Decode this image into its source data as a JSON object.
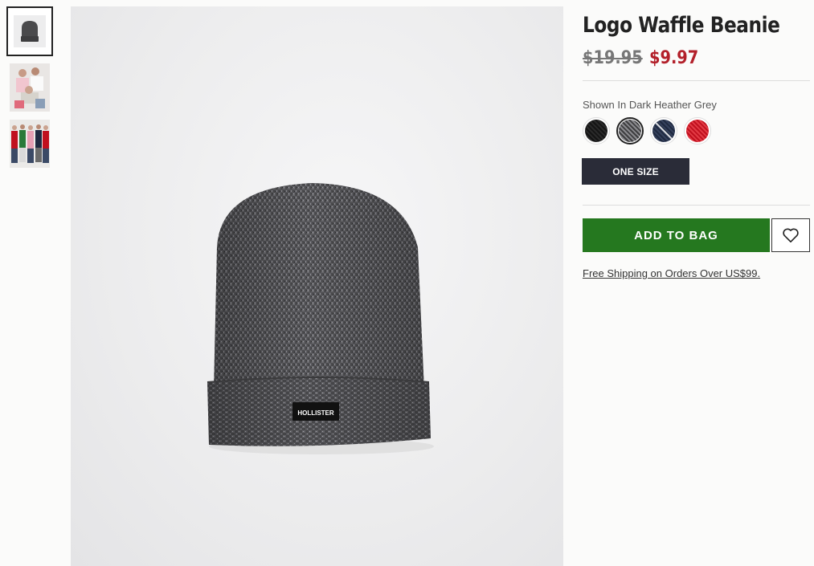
{
  "product": {
    "title": "Logo Waffle Beanie",
    "price_original": "$19.95",
    "price_sale": "$9.97",
    "color_label": "Shown In Dark Heather Grey",
    "size_label": "ONE SIZE",
    "add_to_bag_label": "ADD TO BAG",
    "shipping_link": "Free Shipping on Orders Over US$99.",
    "patch_text": "HOLLISTER"
  },
  "thumbnails": [
    {
      "name": "beanie-product",
      "active": true
    },
    {
      "name": "lifestyle-group",
      "active": false
    },
    {
      "name": "lifestyle-lineup",
      "active": false
    }
  ],
  "swatches": [
    {
      "name": "black",
      "color": "#141414",
      "selected": false,
      "unavailable": false
    },
    {
      "name": "dark-heather-grey",
      "color": "#555555",
      "selected": true,
      "unavailable": false
    },
    {
      "name": "navy",
      "color": "#1f2940",
      "selected": false,
      "unavailable": true
    },
    {
      "name": "red",
      "color": "#c0101e",
      "selected": false,
      "unavailable": false
    }
  ],
  "colors": {
    "sale_price": "#b3202a",
    "add_to_bag": "#25781f",
    "size_button": "#2a2c38"
  },
  "icons": {
    "wishlist": "heart-icon"
  }
}
